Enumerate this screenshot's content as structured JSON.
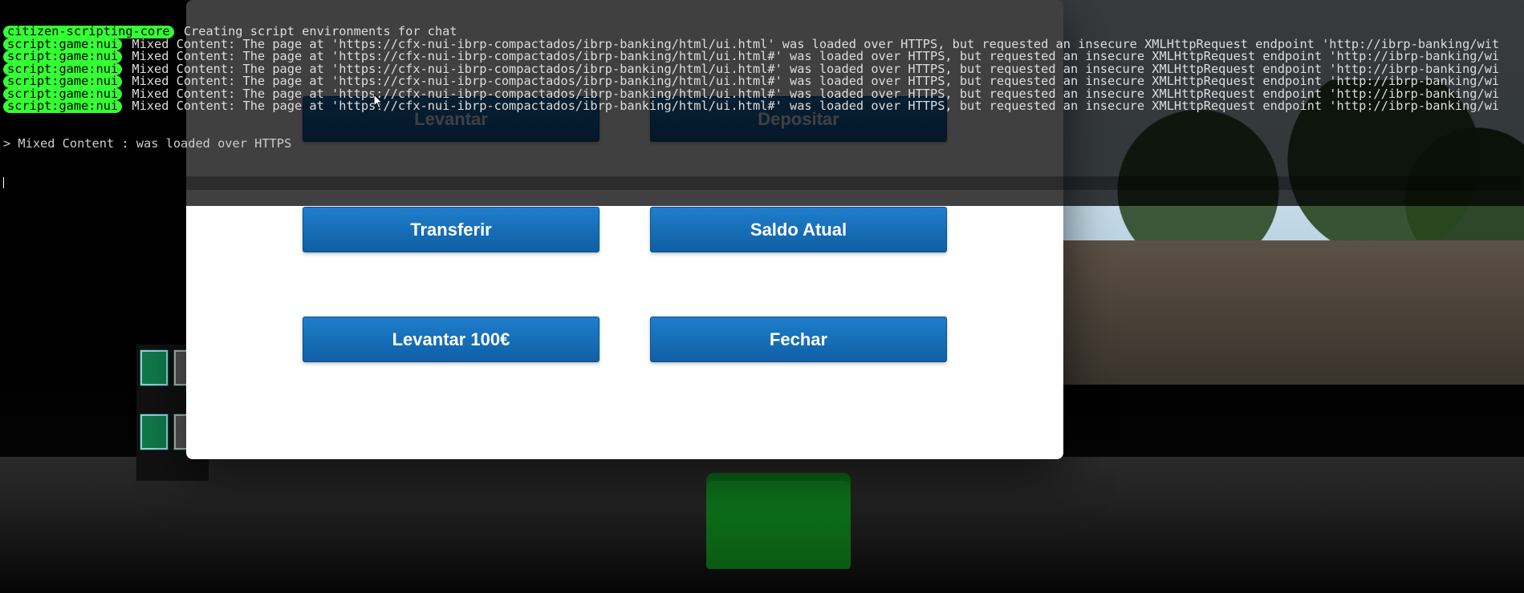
{
  "console": {
    "lines": [
      {
        "tag": "citizen-scripting-core",
        "text": "Creating script environments for chat"
      },
      {
        "tag": "script:game:nui",
        "text": "Mixed Content: The page at 'https://cfx-nui-ibrp-compactados/ibrp-banking/html/ui.html' was loaded over HTTPS, but requested an insecure XMLHttpRequest endpoint 'http://ibrp-banking/wit"
      },
      {
        "tag": "script:game:nui",
        "text": "Mixed Content: The page at 'https://cfx-nui-ibrp-compactados/ibrp-banking/html/ui.html#' was loaded over HTTPS, but requested an insecure XMLHttpRequest endpoint 'http://ibrp-banking/wi"
      },
      {
        "tag": "script:game:nui",
        "text": "Mixed Content: The page at 'https://cfx-nui-ibrp-compactados/ibrp-banking/html/ui.html#' was loaded over HTTPS, but requested an insecure XMLHttpRequest endpoint 'http://ibrp-banking/wi"
      },
      {
        "tag": "script:game:nui",
        "text": "Mixed Content: The page at 'https://cfx-nui-ibrp-compactados/ibrp-banking/html/ui.html#' was loaded over HTTPS, but requested an insecure XMLHttpRequest endpoint 'http://ibrp-banking/wi"
      },
      {
        "tag": "script:game:nui",
        "text": "Mixed Content: The page at 'https://cfx-nui-ibrp-compactados/ibrp-banking/html/ui.html#' was loaded over HTTPS, but requested an insecure XMLHttpRequest endpoint 'http://ibrp-banking/wi"
      },
      {
        "tag": "script:game:nui",
        "text": "Mixed Content: The page at 'https://cfx-nui-ibrp-compactados/ibrp-banking/html/ui.html#' was loaded over HTTPS, but requested an insecure XMLHttpRequest endpoint 'http://ibrp-banking/wi"
      }
    ],
    "prompt": "> Mixed Content : was loaded over HTTPS"
  },
  "bank": {
    "buttons": {
      "levantar": "Levantar",
      "depositar": "Depositar",
      "transferir": "Transferir",
      "saldo": "Saldo Atual",
      "lev100": "Levantar 100€",
      "fechar": "Fechar"
    }
  }
}
